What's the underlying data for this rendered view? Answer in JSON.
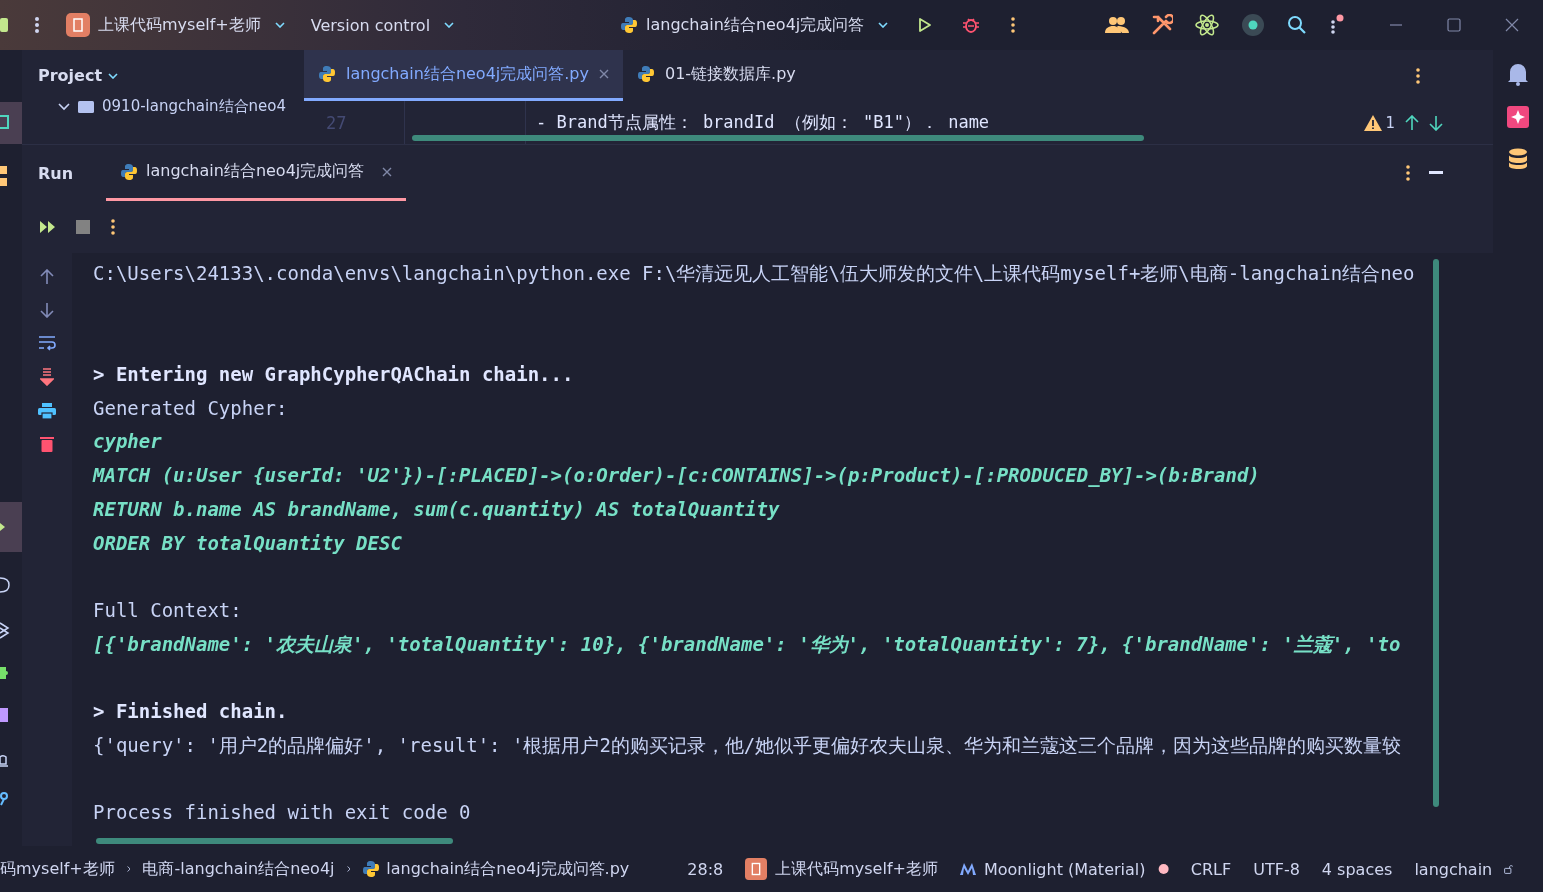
{
  "title_bar": {
    "project": "上课代码myself+老师",
    "vcs": "Version control",
    "run_config": "langchain结合neo4j完成问答"
  },
  "project_panel": {
    "title": "Project",
    "tree": [
      {
        "label": "0910-langchain结合neo4",
        "expanded": true
      }
    ]
  },
  "editor": {
    "tabs": [
      {
        "label": "langchain结合neo4j完成问答.py",
        "selected": true
      },
      {
        "label": "01-链接数据库.py",
        "selected": false
      }
    ],
    "line_number": "27",
    "code_line": "- Brand节点属性： brandId （例如： \"B1\"）． name",
    "warnings": "1"
  },
  "run": {
    "title": "Run",
    "tabs": [
      {
        "label": "langchain结合neo4j完成问答",
        "selected": true
      }
    ],
    "blocks": [
      [
        {
          "kind": "plain",
          "text": "C:\\Users\\24133\\.conda\\envs\\langchain\\python.exe F:\\华清远见人工智能\\伍大师发的文件\\上课代码myself+老师\\电商-langchain结合neo"
        }
      ],
      [
        {
          "kind": "bold",
          "text": "> Entering new GraphCypherQAChain chain..."
        },
        {
          "kind": "plain",
          "text": "Generated Cypher:"
        },
        {
          "kind": "query",
          "text": "cypher"
        },
        {
          "kind": "query",
          "text": "MATCH (u:User {userId: 'U2'})-[:PLACED]->(o:Order)-[c:CONTAINS]->(p:Product)-[:PRODUCED_BY]->(b:Brand)"
        },
        {
          "kind": "query",
          "text": "RETURN b.name AS brandName, sum(c.quantity) AS totalQuantity"
        },
        {
          "kind": "query",
          "text": "ORDER BY totalQuantity DESC"
        }
      ],
      [
        {
          "kind": "plain",
          "text": "Full Context:"
        },
        {
          "kind": "query",
          "text": "[{'brandName': '农夫山泉', 'totalQuantity': 10}, {'brandName': '华为', 'totalQuantity': 7}, {'brandName': '兰蔻', 'to"
        }
      ],
      [
        {
          "kind": "bold",
          "text": "> Finished chain."
        },
        {
          "kind": "plain",
          "text": "{'query': '用户2的品牌偏好', 'result': '根据用户2的购买记录，他/她似乎更偏好农夫山泉、华为和兰蔻这三个品牌，因为这些品牌的购买数量较"
        }
      ],
      [
        {
          "kind": "plain",
          "text": "Process finished with exit code 0"
        }
      ]
    ]
  },
  "status_bar": {
    "breadcrumbs": [
      "码myself+老师",
      "电商-langchain结合neo4j",
      "langchain结合neo4j完成问答.py"
    ],
    "position": "28:8",
    "project": "上课代码myself+老师",
    "theme": "Moonlight (Material)",
    "line_ending": "CRLF",
    "encoding": "UTF-8",
    "indent": "4 spaces",
    "interpreter": "langchain"
  }
}
